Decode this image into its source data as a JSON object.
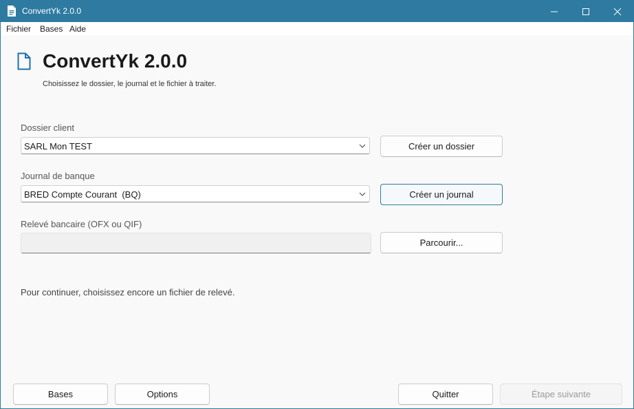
{
  "window": {
    "title": "ConvertYk 2.0.0"
  },
  "menu": {
    "items": [
      "Fichier",
      "Bases",
      "Aide"
    ]
  },
  "header": {
    "title": "ConvertYk 2.0.0",
    "subtitle": "Choisissez le dossier, le journal et le fichier à traiter."
  },
  "form": {
    "dossier": {
      "label": "Dossier client",
      "value": "SARL Mon TEST",
      "button": "Créer un dossier"
    },
    "journal": {
      "label": "Journal de banque",
      "value": "BRED Compte Courant  (BQ)",
      "button": "Créer un journal"
    },
    "releve": {
      "label": "Relevé bancaire (OFX ou QIF)",
      "value": "",
      "button": "Parcourir..."
    }
  },
  "status": {
    "text": "Pour continuer, choisissez encore un fichier de relevé."
  },
  "footer": {
    "bases": "Bases",
    "options": "Options",
    "quitter": "Quitter",
    "next": "Étape suivante"
  },
  "colors": {
    "titlebar": "#2e7aa0",
    "accent": "#2e7aa0",
    "icon_blue": "#1f6fb2"
  },
  "icons": {
    "app": "document-icon",
    "heading": "document-outline-icon"
  }
}
